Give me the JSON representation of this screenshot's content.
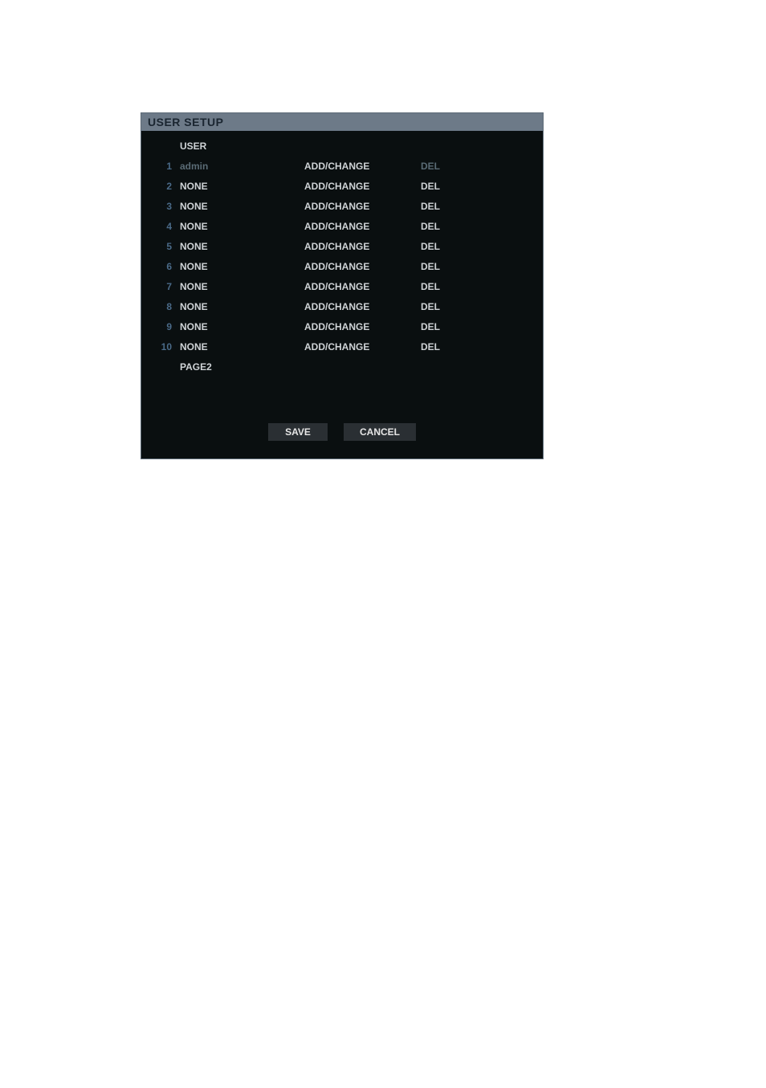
{
  "title": "USER SETUP",
  "header": {
    "user_label": "USER"
  },
  "rows": [
    {
      "num": "1",
      "user": "admin",
      "addchange": "ADD/CHANGE",
      "del": "DEL",
      "user_dim": true,
      "del_dim": true
    },
    {
      "num": "2",
      "user": "NONE",
      "addchange": "ADD/CHANGE",
      "del": "DEL",
      "user_dim": false,
      "del_dim": false
    },
    {
      "num": "3",
      "user": "NONE",
      "addchange": "ADD/CHANGE",
      "del": "DEL",
      "user_dim": false,
      "del_dim": false
    },
    {
      "num": "4",
      "user": "NONE",
      "addchange": "ADD/CHANGE",
      "del": "DEL",
      "user_dim": false,
      "del_dim": false
    },
    {
      "num": "5",
      "user": "NONE",
      "addchange": "ADD/CHANGE",
      "del": "DEL",
      "user_dim": false,
      "del_dim": false
    },
    {
      "num": "6",
      "user": "NONE",
      "addchange": "ADD/CHANGE",
      "del": "DEL",
      "user_dim": false,
      "del_dim": false
    },
    {
      "num": "7",
      "user": "NONE",
      "addchange": "ADD/CHANGE",
      "del": "DEL",
      "user_dim": false,
      "del_dim": false
    },
    {
      "num": "8",
      "user": "NONE",
      "addchange": "ADD/CHANGE",
      "del": "DEL",
      "user_dim": false,
      "del_dim": false
    },
    {
      "num": "9",
      "user": "NONE",
      "addchange": "ADD/CHANGE",
      "del": "DEL",
      "user_dim": false,
      "del_dim": false
    },
    {
      "num": "10",
      "user": "NONE",
      "addchange": "ADD/CHANGE",
      "del": "DEL",
      "user_dim": false,
      "del_dim": false
    }
  ],
  "page_label": "PAGE2",
  "buttons": {
    "save": "SAVE",
    "cancel": "CANCEL"
  }
}
